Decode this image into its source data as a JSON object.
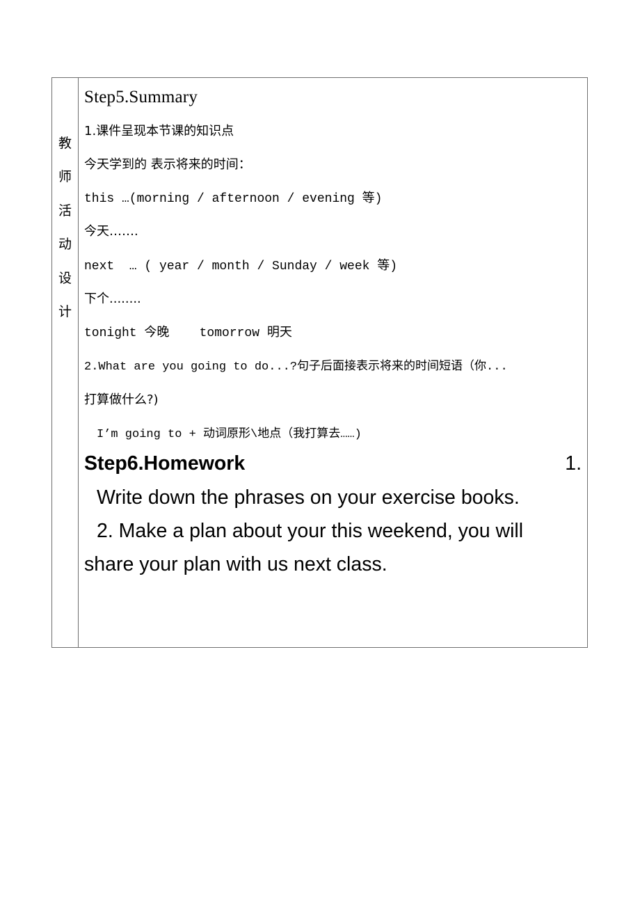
{
  "table": {
    "side_label": [
      "教",
      "师",
      "活",
      "动",
      "设",
      "计"
    ],
    "summary": {
      "title": "Step5.Summary",
      "point1": "1.课件呈现本节课的知识点",
      "intro": "今天学到的 表示将来的时间：",
      "this_line": "this …(morning / afternoon / evening 等)",
      "this_meaning": "今天…….",
      "next_line": "next  … ( year / month / Sunday / week 等)",
      "next_meaning": "下个........",
      "tonight_line": "tonight 今晚    tomorrow 明天",
      "point2_line1": "2.What are you going to do...?句子后面接表示将来的时间短语（你...",
      "point2_line2": "打算做什么?)",
      "pattern": "I’m going to + 动词原形\\地点（我打算去……)"
    },
    "homework": {
      "title": "Step6.Homework",
      "item1_number": "1.",
      "item1_text": "Write down the phrases on your exercise books.",
      "item2_line1": "2. Make a plan about your this weekend, you will",
      "item2_line2": "share your plan with us next class."
    }
  }
}
